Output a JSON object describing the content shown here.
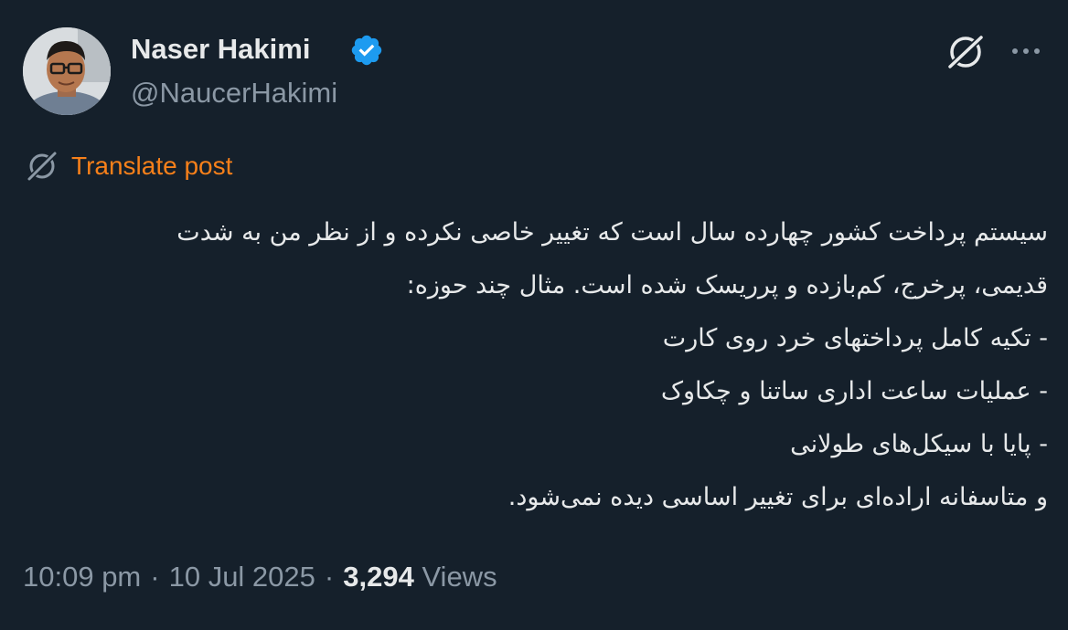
{
  "author": {
    "display_name": "Naser Hakimi",
    "handle": "@NaucerHakimi",
    "avatar_icon": "avatar-photo",
    "verified": true,
    "verified_icon": "verified-badge-icon",
    "verified_color": "#1d9bf0"
  },
  "actions": {
    "grok_icon": "grok-icon",
    "more_icon": "more-dots-icon"
  },
  "translate": {
    "label": "Translate post",
    "icon": "grok-icon",
    "color": "#f7801a"
  },
  "post": {
    "lines": [
      "سیستم پرداخت کشور چهارده سال است که تغییر خاصی نکرده و از نظر من به شدت",
      "قدیمی، پرخرج، کم‌بازده و پرریسک شده است. مثال چند حوزه:",
      "- تکیه کامل پرداختهای خرد روی کارت",
      "- عملیات ساعت اداری ساتنا و چکاوک",
      "- پایا با سیکل‌های طولانی",
      "و متاسفانه اراده‌ای برای تغییر اساسی دیده نمی‌شود."
    ]
  },
  "meta": {
    "time": "10:09 pm",
    "date": "10 Jul 2025",
    "views_count": "3,294",
    "views_label": "Views",
    "separator": "·"
  },
  "colors": {
    "background": "#15202b",
    "text_primary": "#e7e9ea",
    "text_secondary": "#8b98a5"
  }
}
